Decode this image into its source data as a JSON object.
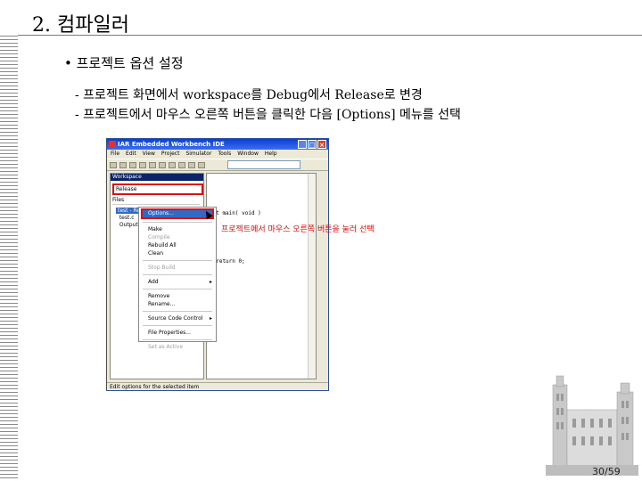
{
  "slide": {
    "title": "2. 컴파일러",
    "bullet": "• 프로젝트 옵션 설정",
    "sub_items": [
      "- 프로젝트 화면에서 workspace를 Debug에서 Release로 변경",
      "- 프로젝트에서 마우스 오른쪽 버튼을 클릭한 다음 [Options] 메뉴를 선택"
    ],
    "annotation": "프로젝트에서 마우스 오른쪽 버튼을 눌러 선택",
    "page_number": "30/59"
  },
  "ide": {
    "title": "IAR Embedded Workbench IDE",
    "menu": [
      "File",
      "Edit",
      "View",
      "Project",
      "Simulator",
      "Tools",
      "Window",
      "Help"
    ],
    "workspace_title": "Workspace",
    "workspace_config": "Release",
    "files_header": "Files",
    "tree": [
      "test - Release",
      "test.c",
      "Output"
    ],
    "code_lines": [
      "int main( void )",
      "{",
      "  return 0;",
      "}"
    ],
    "status": "Edit options for the selected item"
  },
  "context_menu": {
    "items": [
      {
        "label": "Options...",
        "highlight": true
      },
      {
        "label": "Make"
      },
      {
        "label": "Compile",
        "disabled": true
      },
      {
        "label": "Rebuild All"
      },
      {
        "label": "Clean"
      },
      {
        "label": "Stop Build",
        "disabled": true
      },
      {
        "label": "Add",
        "submenu": true
      },
      {
        "label": "Remove"
      },
      {
        "label": "Rename..."
      },
      {
        "label": "Source Code Control",
        "submenu": true
      },
      {
        "label": "File Properties..."
      },
      {
        "label": "Set as Active",
        "disabled": true
      }
    ]
  },
  "colors": {
    "accent_red": "#dd1111",
    "titlebar_blue": "#0a3fd6"
  }
}
